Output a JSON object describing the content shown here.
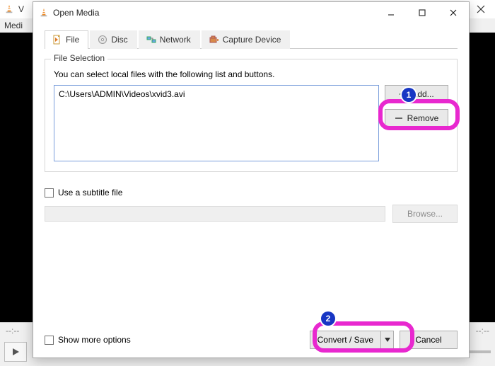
{
  "parent_window": {
    "title_partial": "V",
    "menu_first": "Medi"
  },
  "dialog": {
    "title": "Open Media",
    "tabs": {
      "file": "File",
      "disc": "Disc",
      "network": "Network",
      "capture": "Capture Device"
    }
  },
  "file_selection": {
    "legend": "File Selection",
    "hint": "You can select local files with the following list and buttons.",
    "files": [
      "C:\\Users\\ADMIN\\Videos\\xvid3.avi"
    ],
    "add_label": "Add...",
    "remove_label": "Remove"
  },
  "subtitle": {
    "checkbox_label": "Use a subtitle file",
    "browse_label": "Browse..."
  },
  "footer": {
    "more_label": "Show more options",
    "convert_label": "Convert / Save",
    "cancel_label": "Cancel"
  },
  "annotations": [
    {
      "n": "1"
    },
    {
      "n": "2"
    }
  ]
}
